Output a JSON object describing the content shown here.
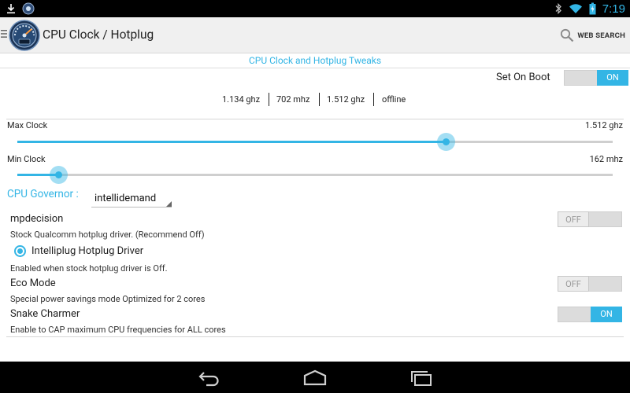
{
  "status_bar": {
    "time": "7:19",
    "icons": [
      "download-icon",
      "notification-app-icon",
      "bluetooth-icon",
      "wifi-icon",
      "battery-charging-icon"
    ]
  },
  "action_bar": {
    "title": "CPU Clock / Hotplug",
    "web_search_label": "WEB SEARCH"
  },
  "subtitle": "CPU Clock and Hotplug Tweaks",
  "set_on_boot": {
    "label": "Set On Boot",
    "state": "ON"
  },
  "frequencies": [
    "1.134 ghz",
    "702 mhz",
    "1.512 ghz",
    "offline"
  ],
  "max_clock": {
    "label": "Max Clock",
    "value": "1.512 ghz",
    "fraction": 0.72
  },
  "min_clock": {
    "label": "Min Clock",
    "value": "162 mhz",
    "fraction": 0.07
  },
  "governor": {
    "label": "CPU Governor :",
    "value": "intellidemand"
  },
  "mpdecision": {
    "title": "mpdecision",
    "description": "Stock Qualcomm hotplug driver. (Recommend Off)",
    "state": "OFF"
  },
  "intelliplug": {
    "title": "Intelliplug Hotplug Driver",
    "description": "Enabled when stock hotplug driver is Off.",
    "selected": true
  },
  "eco_mode": {
    "title": "Eco Mode",
    "description": "Special power savings mode Optimized for 2 cores",
    "state": "OFF"
  },
  "snake_charmer": {
    "title": "Snake Charmer",
    "description": "Enable to CAP maximum CPU frequencies for ALL cores",
    "state": "ON"
  },
  "colors": {
    "accent": "#33b5e5",
    "bar_bg": "#000000",
    "action_bar_bg": "#f0f0f0"
  },
  "nav_bar": {
    "buttons": [
      "back-icon",
      "home-icon",
      "recent-apps-icon"
    ]
  }
}
